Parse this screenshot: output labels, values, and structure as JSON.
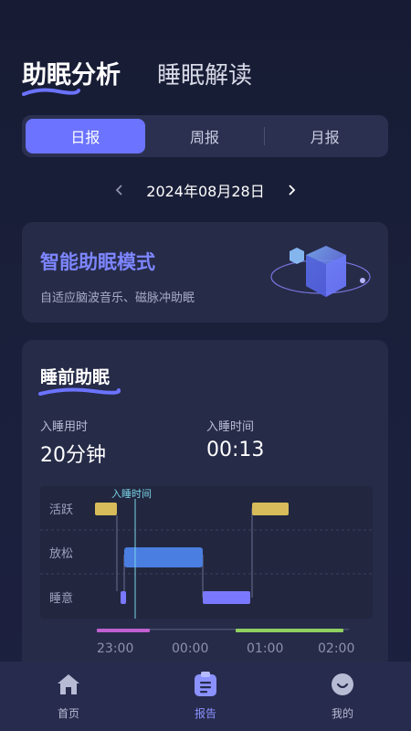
{
  "header": {
    "tabs": [
      {
        "label": "助眠分析",
        "active": true
      },
      {
        "label": "睡眠解读",
        "active": false
      }
    ]
  },
  "period_tabs": {
    "items": [
      "日报",
      "周报",
      "月报"
    ],
    "selected": "日报"
  },
  "date_nav": {
    "date": "2024年08月28日"
  },
  "mode_card": {
    "title": "智能助眠模式",
    "description": "自适应脑波音乐、磁脉冲助眠"
  },
  "sleep_card": {
    "title": "睡前助眠",
    "metrics": [
      {
        "label": "入睡用时",
        "value": "20分钟"
      },
      {
        "label": "入睡时间",
        "value": "00:13"
      }
    ],
    "chart": {
      "levels": [
        "活跃",
        "放松",
        "睡意"
      ],
      "marker_label": "入睡时间",
      "time_labels": [
        "23:00",
        "00:00",
        "01:00",
        "02:00"
      ]
    }
  },
  "bottom_nav": {
    "items": [
      {
        "label": "首页",
        "icon": "home-icon",
        "active": false
      },
      {
        "label": "报告",
        "icon": "report-icon",
        "active": true
      },
      {
        "label": "我的",
        "icon": "profile-icon",
        "active": false
      }
    ]
  },
  "colors": {
    "accent": "#6b73ff",
    "active_bar": "#d8bb5a",
    "relax_bar": "#4a7ee0",
    "sleepy_bar": "#7a78ff",
    "timeline_pink": "#c060d0",
    "timeline_green": "#8fd060"
  }
}
